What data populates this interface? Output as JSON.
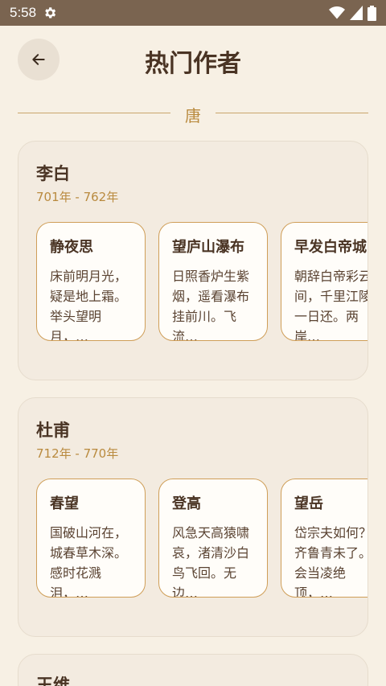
{
  "status_bar": {
    "time": "5:58"
  },
  "header": {
    "title": "热门作者"
  },
  "dynasty": {
    "label": "唐"
  },
  "authors": [
    {
      "name": "李白",
      "years": "701年 - 762年",
      "poems": [
        {
          "title": "静夜思",
          "excerpt": "床前明月光，疑是地上霜。举头望明月，…"
        },
        {
          "title": "望庐山瀑布",
          "excerpt": "日照香炉生紫烟，遥看瀑布挂前川。飞流…"
        },
        {
          "title": "早发白帝城",
          "excerpt": "朝辞白帝彩云间，千里江陵一日还。两岸…"
        }
      ]
    },
    {
      "name": "杜甫",
      "years": "712年 - 770年",
      "poems": [
        {
          "title": "春望",
          "excerpt": "国破山河在，城春草木深。感时花溅泪，…"
        },
        {
          "title": "登高",
          "excerpt": "风急天高猿啸哀，渚清沙白鸟飞回。无边…"
        },
        {
          "title": "望岳",
          "excerpt": "岱宗夫如何？齐鲁青未了。会当凌绝顶，…"
        }
      ]
    },
    {
      "name": "王维"
    }
  ],
  "icons": {
    "back": "arrow-left-icon",
    "settings": "gear-icon",
    "wifi": "wifi-icon",
    "signal": "signal-icon",
    "battery": "battery-icon"
  },
  "colors": {
    "background": "#f7f0e4",
    "status_bar": "#7a6450",
    "accent": "#b98a3e",
    "card_border": "#cf9e58"
  }
}
